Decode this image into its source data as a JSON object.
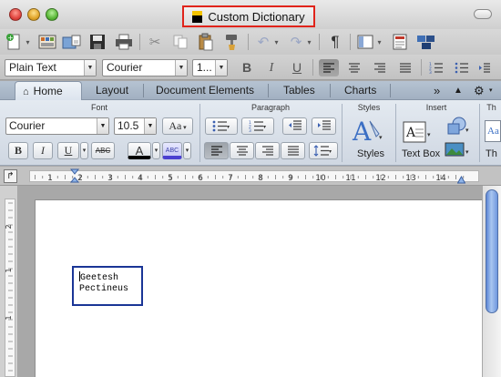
{
  "window": {
    "title": "Custom Dictionary",
    "title_highlight_color": "#e0241b"
  },
  "standard_toolbar": {
    "items": [
      "new-document",
      "templates-gallery",
      "open",
      "save",
      "print",
      "cut",
      "copy",
      "paste",
      "format-painter",
      "undo",
      "redo",
      "show-formatting",
      "view",
      "sidebar",
      "media-browser"
    ],
    "pilcrow": "¶"
  },
  "formatting_toolbar": {
    "style": "Plain Text",
    "font": "Courier",
    "size": "1...",
    "bold": "B",
    "italic": "I",
    "underline": "U"
  },
  "ribbon_tabs": {
    "home": "Home",
    "layout": "Layout",
    "document_elements": "Document Elements",
    "tables": "Tables",
    "charts": "Charts",
    "overflow": "»"
  },
  "ribbon": {
    "font_group_title": "Font",
    "paragraph_group_title": "Paragraph",
    "styles_group_title": "Styles",
    "insert_group_title": "Insert",
    "overflow_group_title": "Th",
    "font_name": "Courier",
    "font_size": "10.5",
    "change_case_label": "Aa",
    "bold": "B",
    "italic": "I",
    "underline": "U",
    "strikethrough": "ABC",
    "font_color_glyph": "A",
    "highlight_glyph": "ABC",
    "styles_label": "Styles",
    "text_box_label": "Text Box",
    "overflow_label": "Th"
  },
  "ruler": {
    "tick_labels": [
      "1",
      "1",
      "2",
      "3",
      "4",
      "5",
      "6",
      "7",
      "8",
      "9",
      "10",
      "11",
      "12",
      "13",
      "14"
    ]
  },
  "vertical_ruler": {
    "tick_labels": [
      "2",
      "1",
      "1"
    ]
  },
  "document": {
    "text_lines": [
      "Geetesh",
      "Pectineus"
    ],
    "textbox_border_color": "#1a3596"
  }
}
